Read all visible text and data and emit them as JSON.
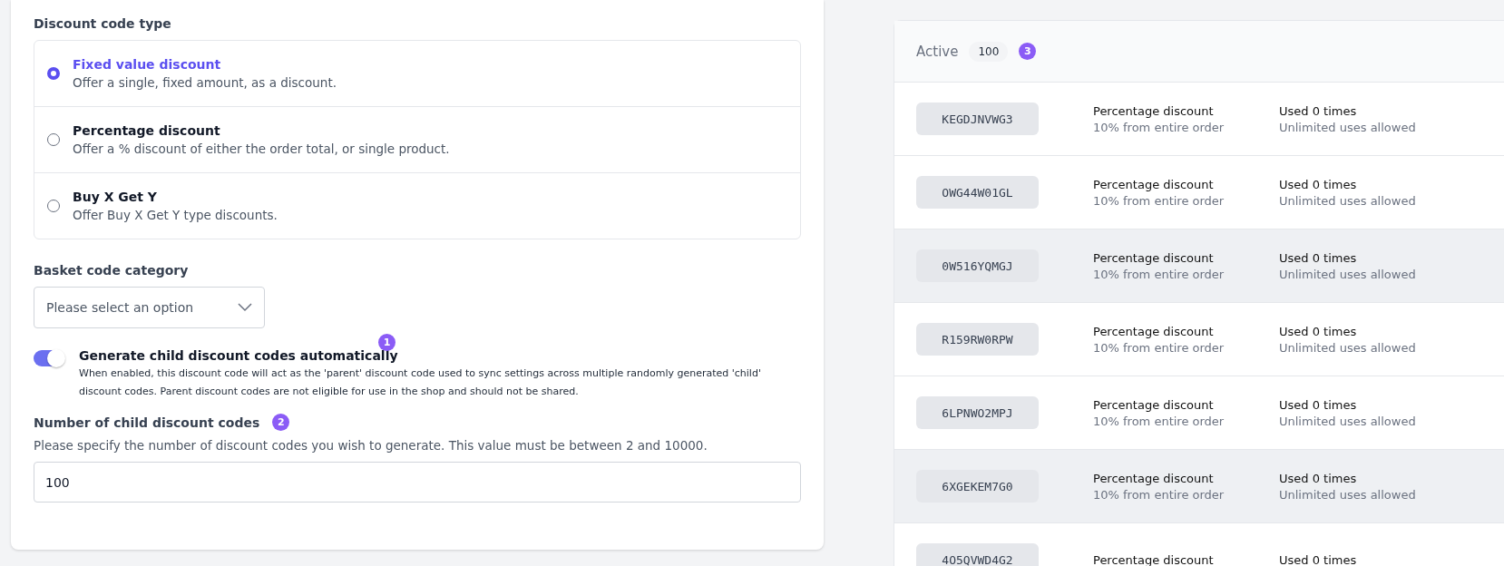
{
  "discount_form": {
    "type_label": "Discount code type",
    "options": [
      {
        "title": "Fixed value discount",
        "description": "Offer a single, fixed amount, as a discount.",
        "selected": true
      },
      {
        "title": "Percentage discount",
        "description": "Offer a % discount of either the order total, or single product.",
        "selected": false
      },
      {
        "title": "Buy X Get Y",
        "description": "Offer Buy X Get Y type discounts.",
        "selected": false
      }
    ],
    "category_label": "Basket code category",
    "category_select": {
      "placeholder": "Please select an option"
    },
    "generate_toggle": {
      "label": "Generate child discount codes automatically",
      "on": true,
      "description": "When enabled, this discount code will act as the 'parent' discount code used to sync settings across multiple randomly generated 'child' discount codes. Parent discount codes are not eligible for use in the shop and should not be shared.",
      "step": "1"
    },
    "child_count": {
      "label": "Number of child discount codes",
      "step": "2",
      "help": "Please specify the number of discount codes you wish to generate. This value must be between 2 and 10000.",
      "value": "100"
    }
  },
  "codes_panel": {
    "tab_label": "Active",
    "count": "100",
    "step": "3",
    "rows": [
      {
        "code": "KEGDJNVWG3",
        "type": "Percentage discount",
        "detail": "10% from entire order",
        "usage": "Used 0 times",
        "limit": "Unlimited uses allowed",
        "highlighted": false
      },
      {
        "code": "OWG44W01GL",
        "type": "Percentage discount",
        "detail": "10% from entire order",
        "usage": "Used 0 times",
        "limit": "Unlimited uses allowed",
        "highlighted": false
      },
      {
        "code": "0W516YQMGJ",
        "type": "Percentage discount",
        "detail": "10% from entire order",
        "usage": "Used 0 times",
        "limit": "Unlimited uses allowed",
        "highlighted": true
      },
      {
        "code": "R159RW0RPW",
        "type": "Percentage discount",
        "detail": "10% from entire order",
        "usage": "Used 0 times",
        "limit": "Unlimited uses allowed",
        "highlighted": false
      },
      {
        "code": "6LPNWO2MPJ",
        "type": "Percentage discount",
        "detail": "10% from entire order",
        "usage": "Used 0 times",
        "limit": "Unlimited uses allowed",
        "highlighted": false
      },
      {
        "code": "6XGEKEM7G0",
        "type": "Percentage discount",
        "detail": "10% from entire order",
        "usage": "Used 0 times",
        "limit": "Unlimited uses allowed",
        "highlighted": true
      },
      {
        "code": "4O5QVWD4G2",
        "type": "Percentage discount",
        "usage": "Used 0 times",
        "highlighted": false
      }
    ]
  }
}
